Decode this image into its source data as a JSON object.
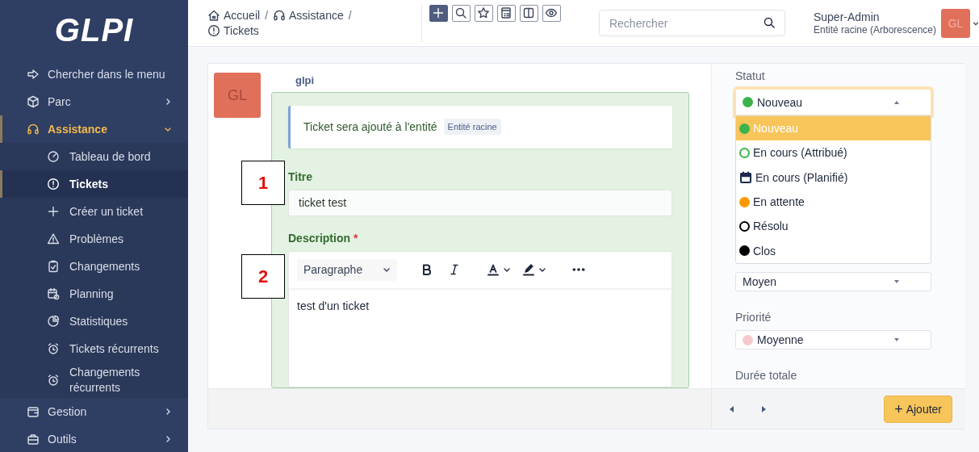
{
  "sidebar": {
    "logo": "GLPI",
    "items": [
      {
        "label": "Chercher dans le menu",
        "kind": "search",
        "selected": false
      },
      {
        "label": "Parc",
        "kind": "section",
        "selected": false,
        "expanded": false
      },
      {
        "label": "Assistance",
        "kind": "section",
        "selected": true,
        "expanded": true,
        "children": [
          {
            "label": "Tableau de bord",
            "selected": false
          },
          {
            "label": "Tickets",
            "selected": true
          },
          {
            "label": "Créer un ticket",
            "selected": false
          },
          {
            "label": "Problèmes",
            "selected": false
          },
          {
            "label": "Changements",
            "selected": false
          },
          {
            "label": "Planning",
            "selected": false
          },
          {
            "label": "Statistiques",
            "selected": false
          },
          {
            "label": "Tickets récurrents",
            "selected": false
          },
          {
            "label": "Changements récurrents",
            "selected": false
          }
        ]
      },
      {
        "label": "Gestion",
        "kind": "section",
        "selected": false,
        "expanded": false
      },
      {
        "label": "Outils",
        "kind": "section",
        "selected": false,
        "expanded": false
      }
    ]
  },
  "header": {
    "breadcrumbs": [
      "Accueil",
      "Assistance",
      "Tickets"
    ],
    "breadcrumb_separator": "/",
    "toolbar": [
      {
        "kind": "primary"
      },
      {
        "kind": "outline"
      },
      {
        "kind": "outline"
      },
      {
        "kind": "outline"
      },
      {
        "kind": "outline"
      },
      {
        "kind": "outline"
      }
    ],
    "search": {
      "placeholder": "Rechercher"
    },
    "user": {
      "name": "Super-Admin",
      "entity": "Entité racine (Arborescence)",
      "avatar": "GL"
    }
  },
  "ticket": {
    "author": "glpi",
    "avatar": "GL",
    "entity_notice": {
      "text": "Ticket sera ajouté à l'entité",
      "badge": "Entité racine"
    },
    "title": {
      "label": "Titre",
      "value": "ticket test"
    },
    "description": {
      "label": "Description",
      "required": true,
      "required_mark": "*",
      "format": "Paragraphe",
      "content": "test d'un ticket"
    },
    "annotations": [
      {
        "label": "1"
      },
      {
        "label": "2"
      }
    ]
  },
  "fields": {
    "status": {
      "label": "Statut",
      "value": "Nouveau",
      "color": "#3cb34a",
      "expanded": true,
      "options": [
        {
          "label": "Nouveau",
          "kind": "dot",
          "color": "#3cb34a",
          "selected": true
        },
        {
          "label": "En cours (Attribué)",
          "kind": "ring",
          "color": "#3cb34a",
          "selected": false
        },
        {
          "label": "En cours (Planifié)",
          "kind": "calendar",
          "color": "#1d2a4d",
          "selected": false
        },
        {
          "label": "En attente",
          "kind": "dot",
          "color": "#ff9800",
          "selected": false
        },
        {
          "label": "Résolu",
          "kind": "ring",
          "color": "#000000",
          "selected": false
        },
        {
          "label": "Clos",
          "kind": "dot",
          "color": "#000000",
          "selected": false
        }
      ]
    },
    "urgency": {
      "value": "Moyen"
    },
    "priority": {
      "label": "Priorité",
      "value": "Moyenne",
      "color": "#f7c9cc"
    },
    "duration": {
      "label": "Durée totale"
    }
  },
  "footer": {
    "button": {
      "icon": "+",
      "label": "Ajouter"
    }
  }
}
